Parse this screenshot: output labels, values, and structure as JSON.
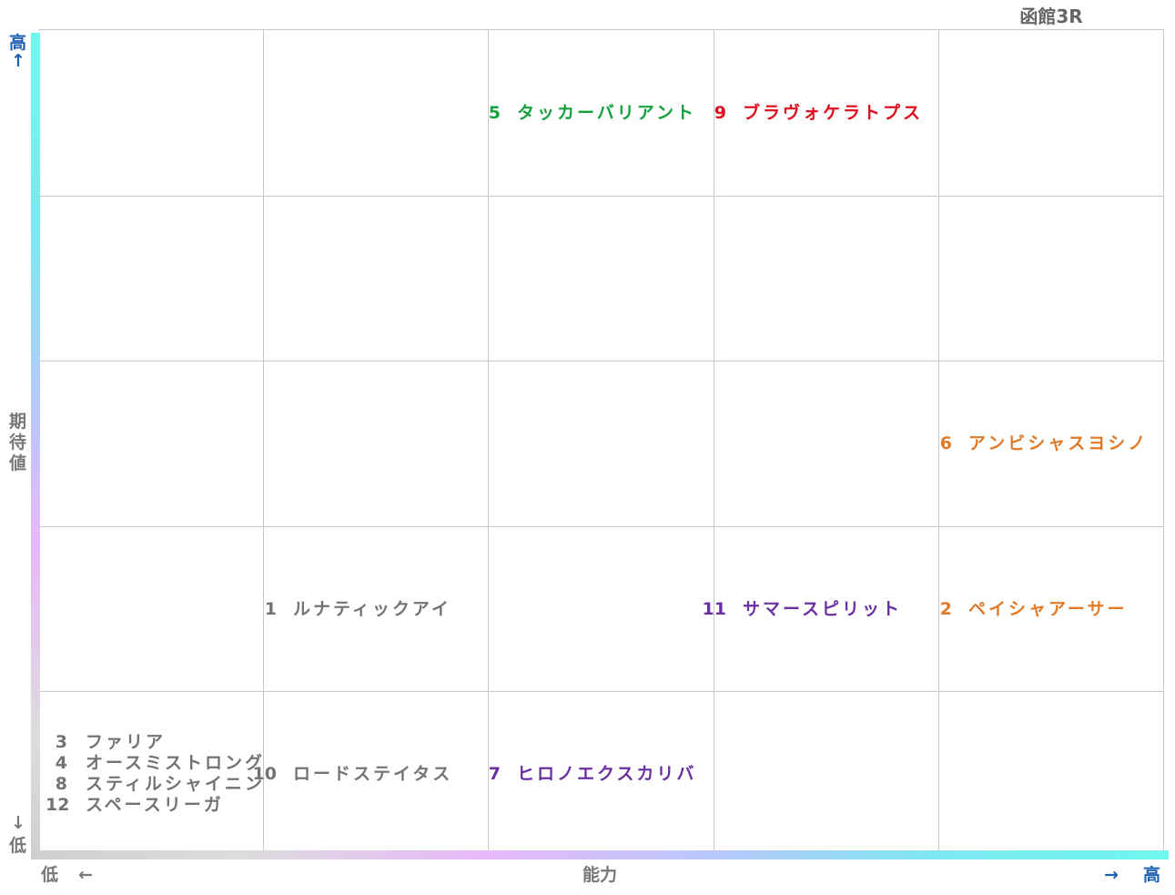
{
  "title": "函館3R",
  "y_axis": {
    "label": "期待値",
    "high": "高",
    "low": "低",
    "up_arrow": "↑",
    "down_arrow": "↓"
  },
  "x_axis": {
    "label": "能力",
    "low": "低",
    "high": "高",
    "left_arrow": "←",
    "right_arrow": "→"
  },
  "colors": {
    "green": "#14a03c",
    "red": "#e00b1c",
    "orange": "#e07a2a",
    "purple": "#6a2fa0",
    "gray": "#737373",
    "axis_blue": "#1f5fb0"
  },
  "grid": {
    "columns": 5,
    "rows": 5
  },
  "entries": {
    "c3r1": {
      "num": "5",
      "name": "タッカーバリアント"
    },
    "c4r1": {
      "num": "9",
      "name": "ブラヴォケラトプス"
    },
    "c5r3": {
      "num": "6",
      "name": "アンビシャスヨシノ"
    },
    "c2r4": {
      "num": "1",
      "name": "ルナティックアイ"
    },
    "c4r4": {
      "num": "11",
      "name": "サマースピリット"
    },
    "c5r4": {
      "num": "2",
      "name": "ペイシャアーサー"
    },
    "c2r5": {
      "num": "10",
      "name": "ロードステイタス"
    },
    "c3r5": {
      "num": "7",
      "name": "ヒロノエクスカリバ"
    },
    "c1r5": [
      {
        "num": "3",
        "name": "ファリア"
      },
      {
        "num": "4",
        "name": "オースミストロング"
      },
      {
        "num": "8",
        "name": "スティルシャイニン"
      },
      {
        "num": "12",
        "name": "スペースリーガ"
      }
    ]
  }
}
